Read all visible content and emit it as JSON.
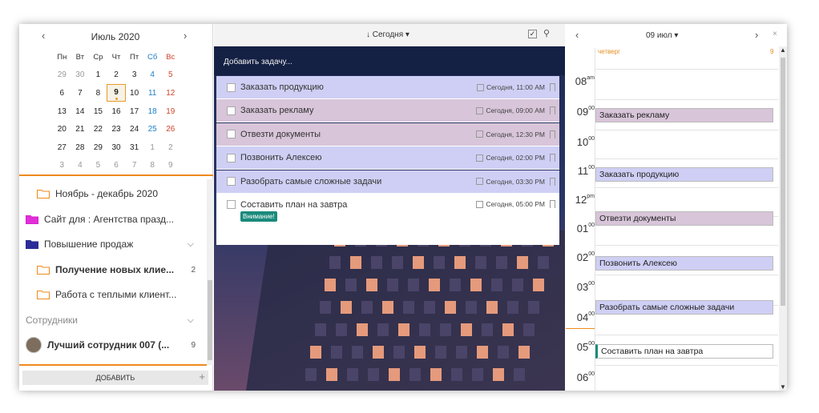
{
  "calendar": {
    "month": "Июль 2020",
    "prev": "‹",
    "next": "›",
    "weekdays": [
      "Пн",
      "Вт",
      "Ср",
      "Чт",
      "Пт",
      "Сб",
      "Вс"
    ],
    "weeks": [
      [
        "29",
        "30",
        "1",
        "2",
        "3",
        "4",
        "5"
      ],
      [
        "6",
        "7",
        "8",
        "9",
        "10",
        "11",
        "12"
      ],
      [
        "13",
        "14",
        "15",
        "16",
        "17",
        "18",
        "19"
      ],
      [
        "20",
        "21",
        "22",
        "23",
        "24",
        "25",
        "26"
      ],
      [
        "27",
        "28",
        "29",
        "30",
        "31",
        "1",
        "2"
      ],
      [
        "3",
        "4",
        "5",
        "6",
        "7",
        "8",
        "9"
      ]
    ],
    "today": "9"
  },
  "projects": [
    {
      "label": "Ноябрь - декабрь 2020",
      "color": "#ef8a1c",
      "fill": "none",
      "indent": true,
      "badge": ""
    },
    {
      "label": "Сайт для : Агентства празд...",
      "color": "#d61fd0",
      "fill": "#e02fd6",
      "indent": false,
      "badge": ""
    },
    {
      "label": "Повышение продаж",
      "color": "#2a2a8a",
      "fill": "#2d2d9a",
      "indent": false,
      "badge": "",
      "chev": "⌵"
    },
    {
      "label": "Получение новых клие...",
      "color": "#ef8a1c",
      "fill": "none",
      "indent": true,
      "badge": "2",
      "bold": true
    },
    {
      "label": "Работа с теплыми клиент...",
      "color": "#ef8a1c",
      "fill": "none",
      "indent": true,
      "badge": ""
    },
    {
      "label": "Сотрудники",
      "section": true,
      "chev": "⌵"
    },
    {
      "label": "Лучший сотрудник 007 (...",
      "avatar": true,
      "badge": "9",
      "bold": true
    }
  ],
  "add_button": "ДОБАВИТЬ",
  "add_plus": "+",
  "middle": {
    "title": "↓ Сегодня ▾",
    "check": "✓",
    "search": "⚲",
    "add_task_placeholder": "Добавить задачу..."
  },
  "tasks": [
    {
      "name": "Заказать продукцию",
      "due": "Сегодня, 11:00 AM",
      "color": "#cfcff5"
    },
    {
      "name": "Заказать рекламу",
      "due": "Сегодня, 09:00 AM",
      "color": "#d8c5d9"
    },
    {
      "name": "Отвезти документы",
      "due": "Сегодня, 12:30 PM",
      "color": "#d8c5d9"
    },
    {
      "name": "Позвонить Алексею",
      "due": "Сегодня, 02:00 PM",
      "color": "#cfcff5"
    },
    {
      "name": "Разобрать самые сложные задачи",
      "due": "Сегодня, 03:30 PM",
      "color": "#cfcff5"
    },
    {
      "name": "Составить план на завтра",
      "due": "Сегодня, 05:00 PM",
      "color": "#ffffff",
      "tag": "Внимание!"
    }
  ],
  "right": {
    "prev": "‹",
    "next": "›",
    "close": "×",
    "date": "09 июл ▾",
    "day_name": "четверг",
    "day_num": "9",
    "hours": [
      {
        "h": "08",
        "s": "am"
      },
      {
        "h": "09",
        "s": "00"
      },
      {
        "h": "10",
        "s": "00"
      },
      {
        "h": "11",
        "s": "00"
      },
      {
        "h": "12",
        "s": "pm"
      },
      {
        "h": "01",
        "s": "00"
      },
      {
        "h": "02",
        "s": "00"
      },
      {
        "h": "03",
        "s": "00"
      },
      {
        "h": "04",
        "s": "00"
      },
      {
        "h": "05",
        "s": "00"
      },
      {
        "h": "06",
        "s": "00"
      }
    ],
    "events": [
      {
        "name": "Заказать рекламу",
        "color": "#d8c5d9"
      },
      {
        "name": "Заказать продукцию",
        "color": "#cfcff5"
      },
      {
        "name": "Отвезти документы",
        "color": "#d8c5d9"
      },
      {
        "name": "Позвонить Алексею",
        "color": "#cfcff5"
      },
      {
        "name": "Разобрать самые сложные задачи",
        "color": "#cfcff5"
      },
      {
        "name": "Составить план на завтра",
        "color": "#ffffff",
        "accent": "#1a8a7c"
      }
    ]
  }
}
